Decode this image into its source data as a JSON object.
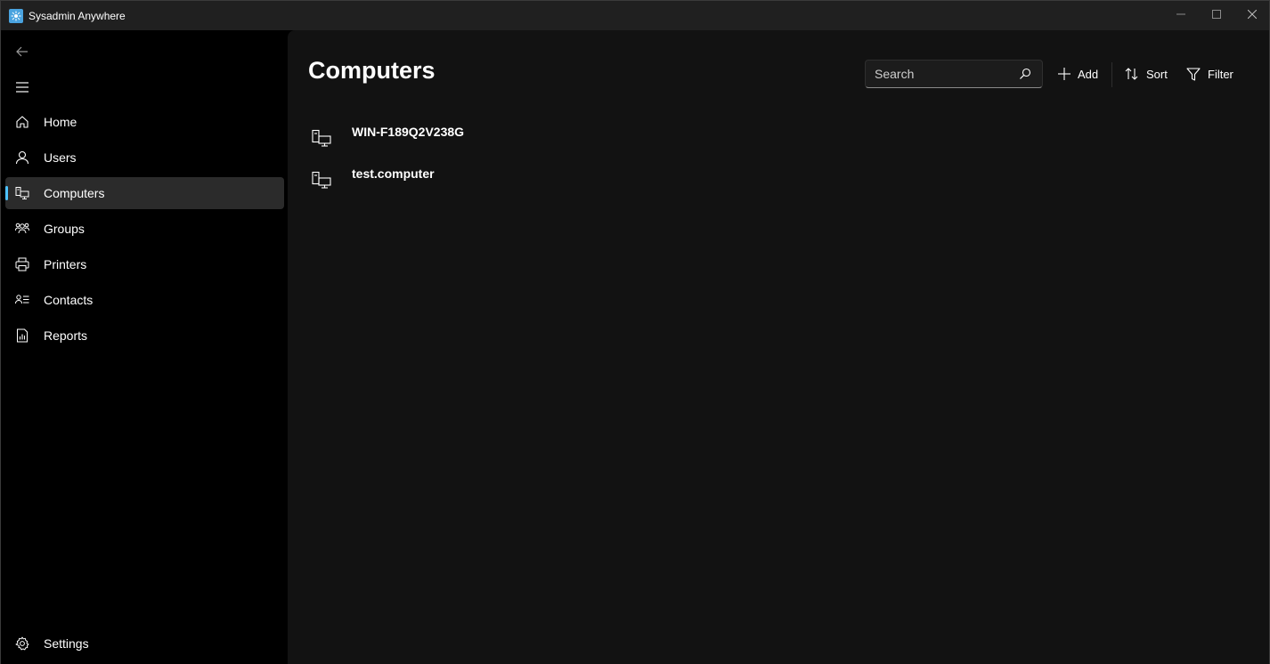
{
  "app": {
    "title": "Sysadmin Anywhere"
  },
  "window_controls": {
    "minimize_icon": "minimize-icon",
    "maximize_icon": "maximize-icon",
    "close_icon": "close-icon"
  },
  "sidebar": {
    "items": [
      {
        "label": "Home",
        "icon": "home-icon",
        "selected": false
      },
      {
        "label": "Users",
        "icon": "user-icon",
        "selected": false
      },
      {
        "label": "Computers",
        "icon": "computers-icon",
        "selected": true
      },
      {
        "label": "Groups",
        "icon": "group-icon",
        "selected": false
      },
      {
        "label": "Printers",
        "icon": "printer-icon",
        "selected": false
      },
      {
        "label": "Contacts",
        "icon": "contacts-icon",
        "selected": false
      },
      {
        "label": "Reports",
        "icon": "report-icon",
        "selected": false
      }
    ],
    "settings": {
      "label": "Settings",
      "icon": "gear-icon"
    }
  },
  "main": {
    "title": "Computers",
    "search": {
      "placeholder": "Search",
      "value": ""
    },
    "toolbar": {
      "add_label": "Add",
      "sort_label": "Sort",
      "filter_label": "Filter"
    },
    "computers": [
      {
        "name": "WIN-F189Q2V238G"
      },
      {
        "name": "test.computer"
      }
    ]
  },
  "colors": {
    "accent": "#4cc2ff",
    "sidebar_bg": "#000000",
    "content_bg": "#121212",
    "titlebar_bg": "#202020",
    "selected_bg": "#2b2b2b"
  }
}
